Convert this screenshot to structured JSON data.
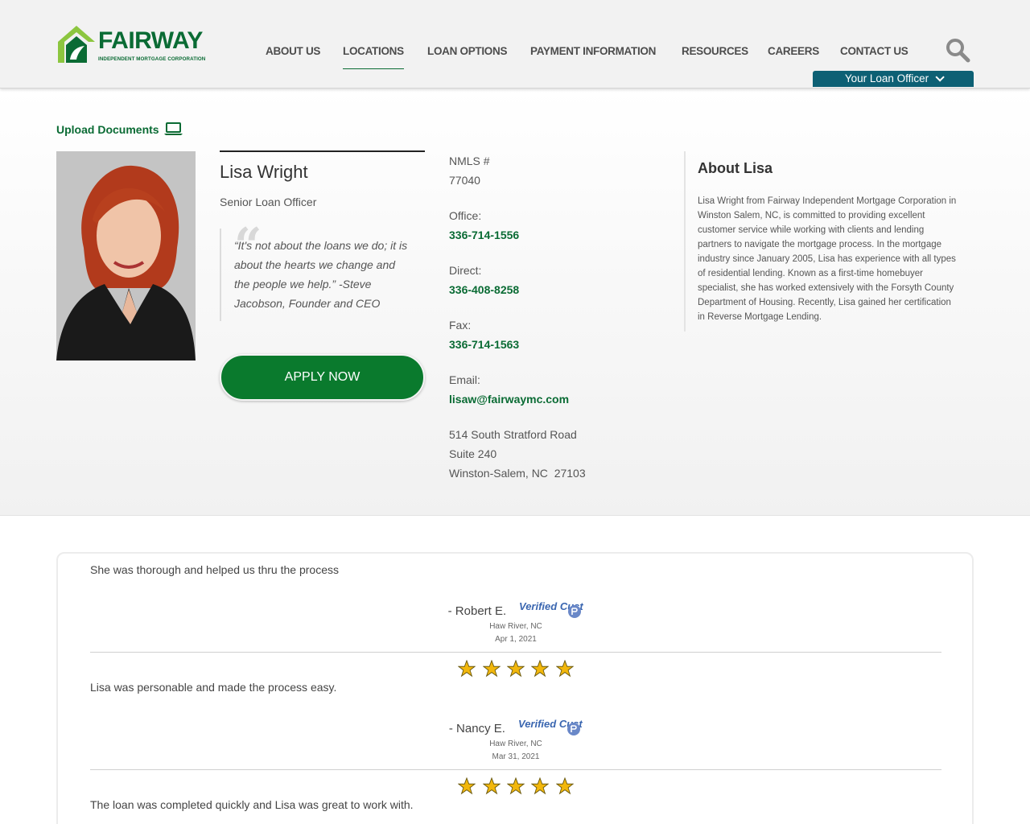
{
  "brand": {
    "name": "FAIRWAY",
    "tagline": "INDEPENDENT MORTGAGE CORPORATION",
    "primary_color": "#0a6b34",
    "accent_color": "#8cc63f",
    "button_teal": "#0d6074"
  },
  "nav": {
    "items": [
      {
        "label": "About Us",
        "active": false
      },
      {
        "label": "Locations",
        "active": true
      },
      {
        "label": "Loan Options",
        "active": false
      },
      {
        "label": "Payment Information",
        "active": false
      },
      {
        "label": "Resources",
        "active": false
      },
      {
        "label": "Careers",
        "active": false
      },
      {
        "label": "Contact Us",
        "active": false
      }
    ],
    "search_icon": "search-icon",
    "loan_officer_button": "Your Loan Officer"
  },
  "profile": {
    "upload_label": "Upload Documents",
    "name": "Lisa Wright",
    "title": "Senior Loan Officer",
    "quote": "“It's not about the loans we do; it is about the hearts we change and the people we help.” -Steve Jacobson, Founder and CEO",
    "apply_label": "APPLY NOW",
    "nmls_label": "NMLS #",
    "nmls": "77040",
    "office_label": "Office:",
    "office": "336-714-1556",
    "direct_label": "Direct:",
    "direct": "336-408-8258",
    "fax_label": "Fax:",
    "fax": "336-714-1563",
    "email_label": "Email:",
    "email": "lisaw@fairwaymc.com",
    "address_line1": "514 South Stratford Road",
    "address_line2": "Suite 240",
    "address_line3": "Winston-Salem, NC  27103",
    "about_title": "About Lisa",
    "about_text": "Lisa Wright from Fairway Independent Mortgage Corporation in Winston Salem, NC, is committed to providing excellent customer service while working with clients and lending partners to navigate the mortgage process. In the mortgage industry since January 2005, Lisa has experience with all types of residential lending. Known as a first-time homebuyer specialist, she has worked extensively with the Forsyth County Department of Housing. Recently, Lisa gained her certification in Reverse Mortgage Lending."
  },
  "reviews": [
    {
      "text": "She was thorough and helped us thru the process",
      "reviewer": "- Robert E.",
      "location": "Haw River, NC",
      "date": "Apr 1, 2021",
      "badge": "Verified Customer"
    },
    {
      "text": "Lisa was personable and made the process easy.",
      "reviewer": "- Nancy E.",
      "location": "Haw River, NC",
      "date": "Mar 31, 2021",
      "badge": "Verified Customer",
      "stars": 5
    },
    {
      "text": "The loan was completed quickly and Lisa was great to work with.",
      "stars": 5
    }
  ]
}
